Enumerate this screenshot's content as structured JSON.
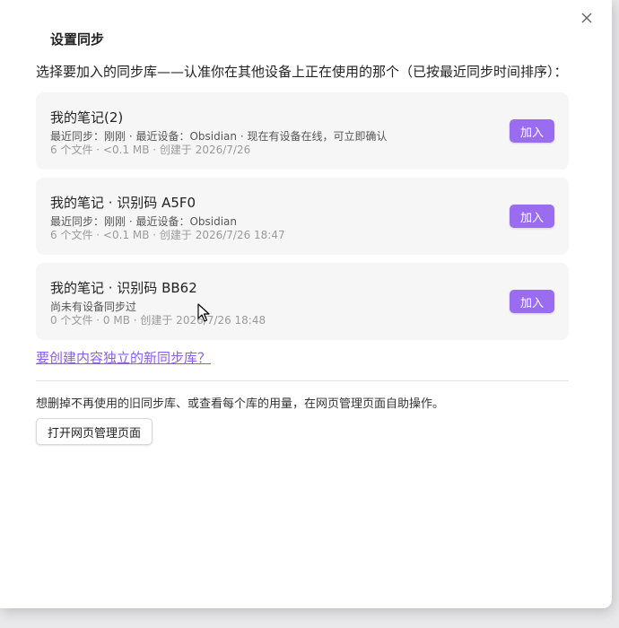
{
  "dialog": {
    "title": "设置同步",
    "prompt": "选择要加入的同步库——认准你在其他设备上正在使用的那个（已按最近同步时间排序）：",
    "close_icon": "close-icon"
  },
  "vaults": [
    {
      "name": "我的笔记(2)",
      "sync_info": "最近同步：刚刚 · 最近设备：Obsidian · 现在有设备在线，可立即确认",
      "meta": "6 个文件 · <0.1 MB · 创建于 2026/7/26",
      "join_label": "加入"
    },
    {
      "name": "我的笔记 · 识别码 A5F0",
      "sync_info": "最近同步：刚刚 · 最近设备：Obsidian",
      "meta": "6 个文件 · <0.1 MB · 创建于 2026/7/26 18:47",
      "join_label": "加入"
    },
    {
      "name": "我的笔记 · 识别码 BB62",
      "sync_info": "尚未有设备同步过",
      "meta": "0 个文件 · 0 MB · 创建于 2026/7/26 18:48",
      "join_label": "加入"
    }
  ],
  "create_link": "要创建内容独立的新同步库？",
  "manage": {
    "hint": "想删掉不再使用的旧同步库、或查看每个库的用量，在网页管理页面自助操作。",
    "button_label": "打开网页管理页面"
  },
  "colors": {
    "accent": "#9a6cf0",
    "link": "#8a5cf0",
    "card_bg": "#f6f6f7"
  }
}
